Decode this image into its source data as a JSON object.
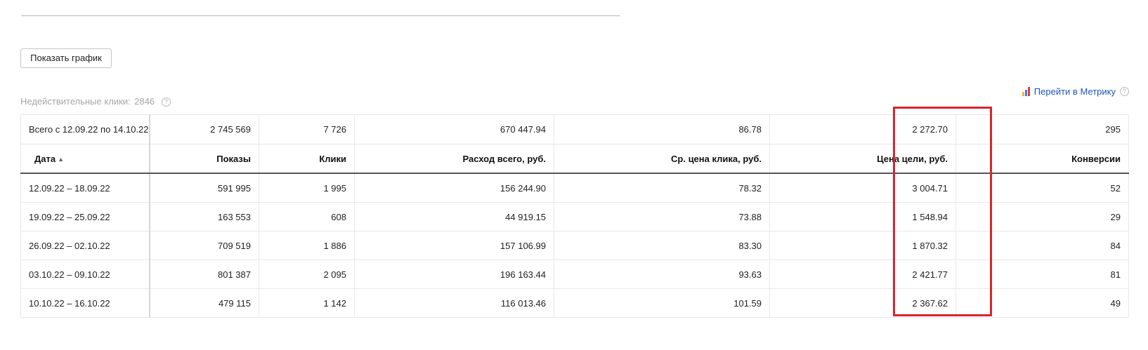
{
  "toolbar": {
    "show_chart_label": "Показать график"
  },
  "invalid_clicks": {
    "label": "Недействительные клики:",
    "value": "2846"
  },
  "metrika": {
    "link_label": "Перейти в Метрику",
    "icon": "metrika-bars-icon",
    "colors": [
      "#f7b32b",
      "#3c7ded",
      "#e63b2e"
    ]
  },
  "help_icon_glyph": "?",
  "table": {
    "total_row": {
      "label": "Всего с 12.09.22 по 14.10.22",
      "shows": "2 745 569",
      "clicks": "7 726",
      "spend": "670 447.94",
      "avg_cpc": "86.78",
      "goal_price": "2 272.70",
      "conversions": "295"
    },
    "columns": {
      "date": "Дата",
      "date_sort_indicator": "▲",
      "shows": "Показы",
      "clicks": "Клики",
      "spend": "Расход всего, руб.",
      "avg_cpc": "Ср. цена клика, руб.",
      "goal_price": "Цена цели, руб.",
      "conversions": "Конверсии"
    },
    "rows": [
      {
        "date": "12.09.22 – 18.09.22",
        "shows": "591 995",
        "clicks": "1 995",
        "spend": "156 244.90",
        "avg_cpc": "78.32",
        "goal_price": "3 004.71",
        "conversions": "52"
      },
      {
        "date": "19.09.22 – 25.09.22",
        "shows": "163 553",
        "clicks": "608",
        "spend": "44 919.15",
        "avg_cpc": "73.88",
        "goal_price": "1 548.94",
        "conversions": "29"
      },
      {
        "date": "26.09.22 – 02.10.22",
        "shows": "709 519",
        "clicks": "1 886",
        "spend": "157 106.99",
        "avg_cpc": "83.30",
        "goal_price": "1 870.32",
        "conversions": "84"
      },
      {
        "date": "03.10.22 – 09.10.22",
        "shows": "801 387",
        "clicks": "2 095",
        "spend": "196 163.44",
        "avg_cpc": "93.63",
        "goal_price": "2 421.77",
        "conversions": "81"
      },
      {
        "date": "10.10.22 – 16.10.22",
        "shows": "479 115",
        "clicks": "1 142",
        "spend": "116 013.46",
        "avg_cpc": "101.59",
        "goal_price": "2 367.62",
        "conversions": "49"
      }
    ]
  },
  "annotation": {
    "highlight_color": "#d9252f",
    "highlighted_column": "goal_price"
  }
}
